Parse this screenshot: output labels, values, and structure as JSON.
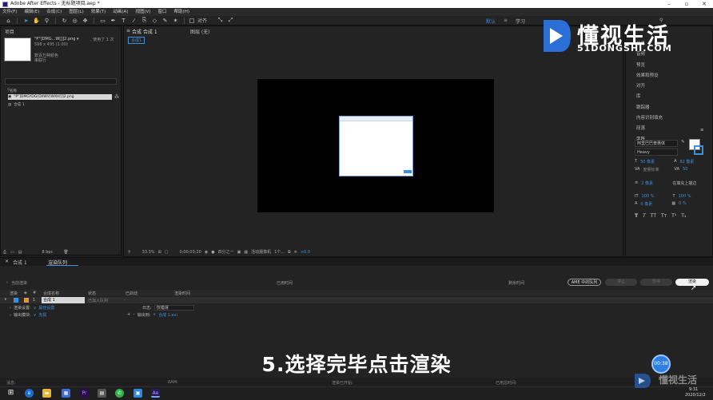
{
  "window": {
    "title": "Adobe After Effects - 无标题项目.aep *"
  },
  "menu": [
    "文件(F)",
    "编辑(E)",
    "合成(C)",
    "图层(L)",
    "效果(T)",
    "动画(A)",
    "视图(V)",
    "窗口",
    "帮助(H)"
  ],
  "toolbar": {
    "snap_label": "对齐"
  },
  "workspace": {
    "default": "默认",
    "learn": "学习"
  },
  "project": {
    "panel_label": "项目",
    "asset_name": "\"P\"]DMG...W[]]2.png ▾",
    "asset_used": ", 使用了 1 次",
    "asset_dims": "598 x 495 (1.00)",
    "asset_color": "数百万种颜色",
    "asset_alpha": "串联行",
    "col_name": "名称",
    "items": [
      "\"P\"]DMGYDG(OXWV)WXH[]]2.png",
      "合成 1"
    ],
    "bpc": "8 bpc"
  },
  "comp_panel": {
    "tab": "合成 合成 1",
    "layer_tab": "图层 (无)",
    "breadcrumb": "合成1"
  },
  "viewer_bar": {
    "zoom": "33.3%",
    "timecode": "0;00;03;20",
    "res": "四分之一",
    "camera": "活动摄像机",
    "views": "1个...",
    "exposure": "+0.0"
  },
  "right_panel": {
    "items": [
      "信息",
      "音频",
      "预览",
      "效果和预设",
      "对齐",
      "库",
      "跟踪器",
      "内容识别填充",
      "段落",
      "字符"
    ],
    "font_family": "阿里巴巴普惠体",
    "font_style": "Heavy",
    "font_size": "50 像素",
    "leading": "82 像素",
    "tracking_label": "度量标准",
    "tracking": "50",
    "stroke_width": "2 像素",
    "stroke_mode": "在填充上描边",
    "vscale": "100 %",
    "hscale": "100 %",
    "baseline": "0 像素",
    "tsume": "0 %",
    "styles": [
      "T",
      "T",
      "TT",
      "Tт",
      "T¹",
      "T₁"
    ]
  },
  "render_queue": {
    "tabs": [
      "合成 1",
      "渲染队列"
    ],
    "current_render": "当前渲染",
    "elapsed": "已用时间",
    "remaining": "剩余时间",
    "ame_button": "AME 中的队列",
    "stop_button": "停止",
    "pause_button": "暂停",
    "render_button": "渲染",
    "cols": [
      "渲染",
      "#",
      "合成名称",
      "状态",
      "已启动",
      "渲染时间"
    ],
    "item_num": "1",
    "item_name": "合成 1",
    "item_status": "已加入队列",
    "render_settings_label": "渲染设置:",
    "render_settings_value": "最佳设置",
    "log_label": "日志:",
    "log_value": "仅错误",
    "output_module_label": "输出模块:",
    "output_module_value": "无损",
    "output_to_label": "输出到:",
    "output_to_value": "合成 1.avi",
    "status_msg": "消息:",
    "status_ram": "RAM:",
    "status_started": "渲染已开始:",
    "status_total": "已用总时间:"
  },
  "caption": "5.选择完毕点击渲染",
  "watermark": {
    "cn": "懂视生活",
    "en": "51DONGSHI.COM"
  },
  "badge": "00:38",
  "clock": {
    "time": "9:31",
    "date": "2020/12/2"
  },
  "colors": {
    "accent": "#3d8fe0",
    "panel": "#232323",
    "bg": "#1d1d1d"
  }
}
